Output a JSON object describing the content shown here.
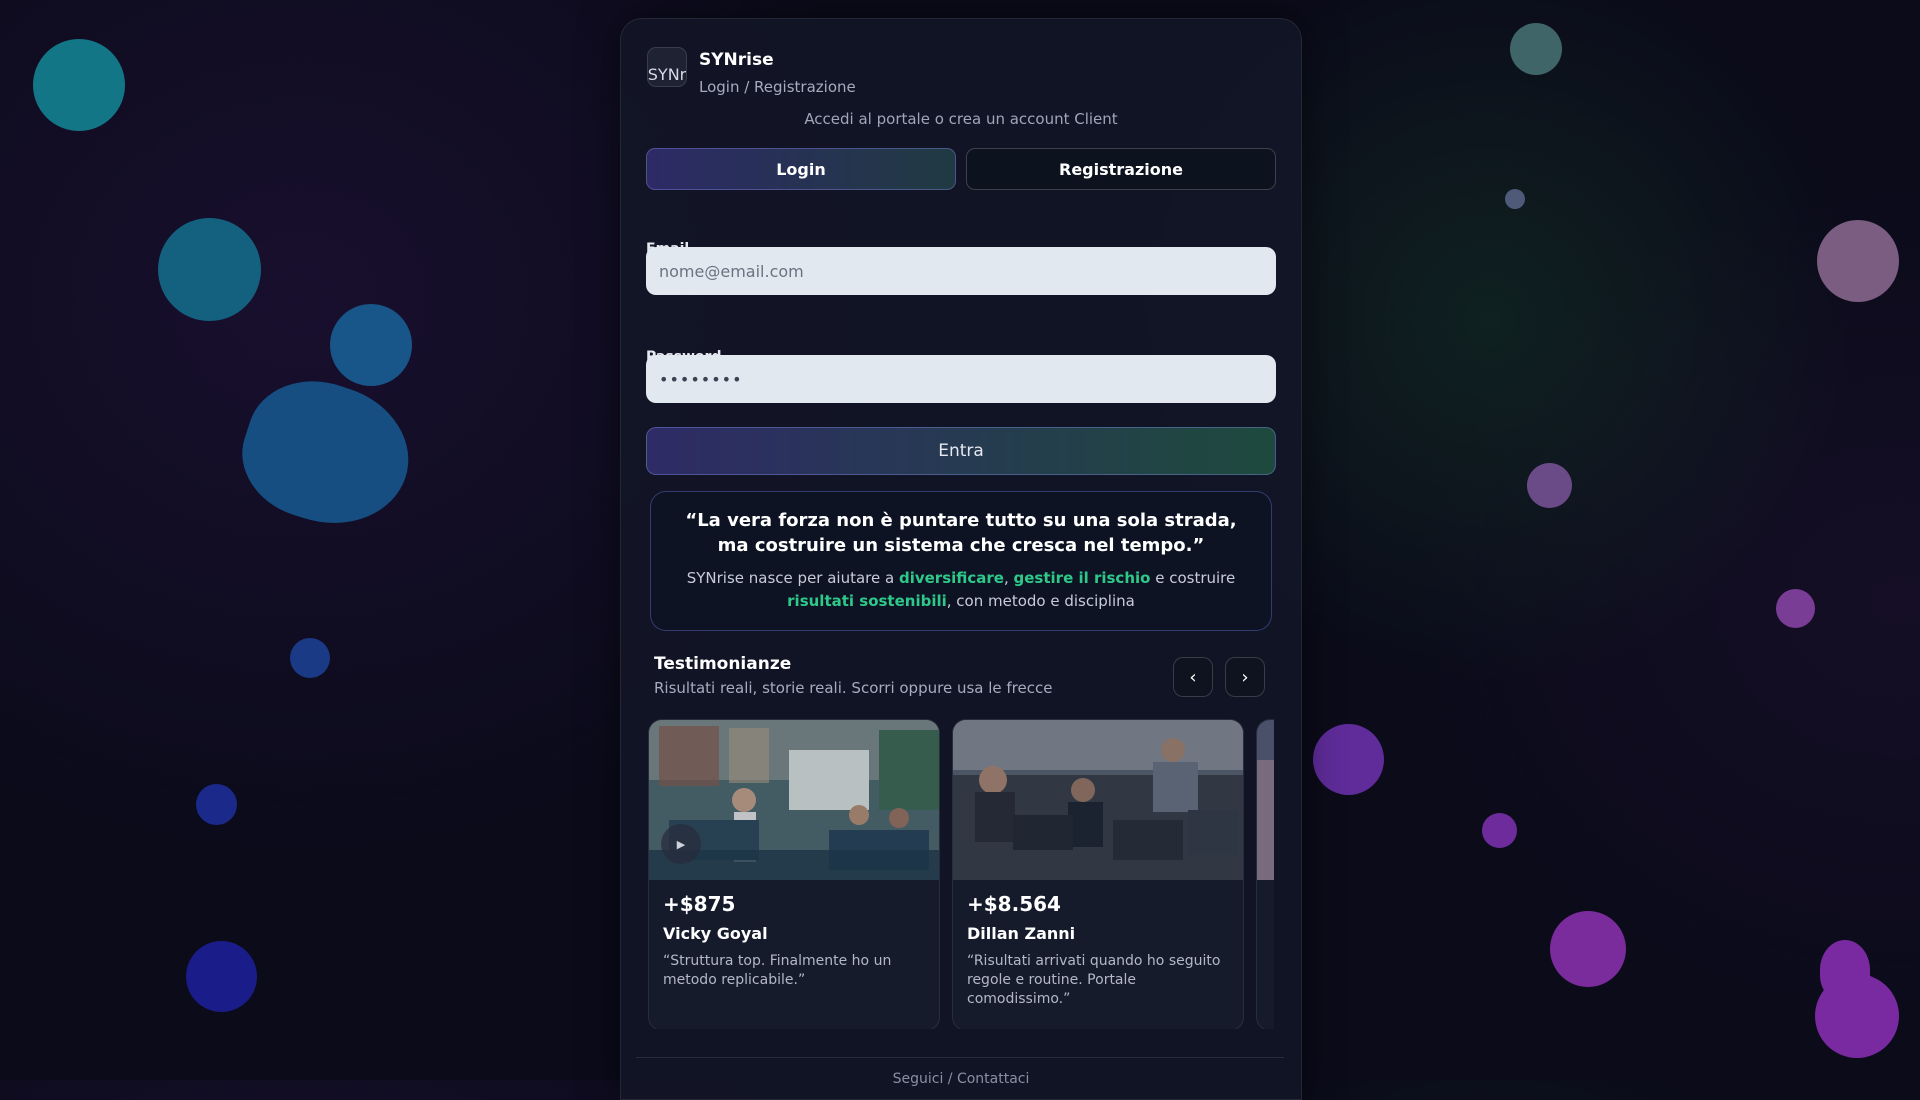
{
  "brand": {
    "logo_alt": "SYNr",
    "name": "SYNrise",
    "subtitle": "Login / Registrazione"
  },
  "tagline": "Accedi al portale o crea un account Client",
  "tabs": [
    {
      "label": "Login",
      "active": true
    },
    {
      "label": "Registrazione",
      "active": false
    }
  ],
  "form": {
    "email_label": "Email",
    "email_placeholder": "nome@email.com",
    "password_label": "Password",
    "password_value": "••••••••",
    "submit_label": "Entra"
  },
  "quote": {
    "text": "“La vera forza non è puntare tutto su una sola strada, ma costruire un sistema che cresca nel tempo.”",
    "body_prefix": "SYNrise nasce per aiutare a ",
    "hl1": "diversificare",
    "sep1": ", ",
    "hl2": "gestire il rischio",
    "sep2": " e costruire ",
    "hl3": "risultati sostenibili",
    "body_suffix": ", con metodo e disciplina"
  },
  "testimonials": {
    "title": "Testimonianze",
    "subtitle": "Risultati reali, storie reali. Scorri oppure usa le frecce",
    "prev_icon": "‹",
    "next_icon": "›",
    "items": [
      {
        "amount": "+$875",
        "name": "Vicky Goyal",
        "quote": "“Struttura top. Finalmente ho un metodo replicabile.”"
      },
      {
        "amount": "+$8.564",
        "name": "Dillan Zanni",
        "quote": "“Risultati arrivati quando ho seguito regole e routine. Portale comodissimo.”"
      }
    ]
  },
  "footer": "Seguici / Contattaci",
  "colors": {
    "accent_green": "#2ec98a",
    "background": "#0b0b1a",
    "input_bg": "#e2e8f0"
  }
}
